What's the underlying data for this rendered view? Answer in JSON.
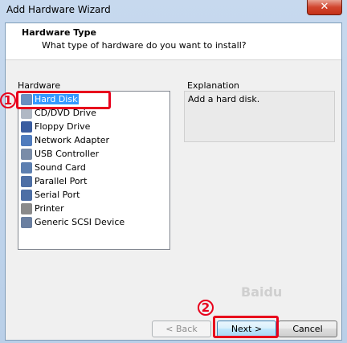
{
  "window": {
    "title": "Add Hardware Wizard",
    "close_glyph": "✕"
  },
  "header": {
    "title": "Hardware Type",
    "subtitle": "What type of hardware do you want to install?"
  },
  "hardware": {
    "label": "Hardware",
    "items": [
      {
        "label": "Hard Disk",
        "icon": "hard-disk-icon",
        "color": "#6a8fc0",
        "selected": true
      },
      {
        "label": "CD/DVD Drive",
        "icon": "cd-dvd-icon",
        "color": "#b0b8c4"
      },
      {
        "label": "Floppy Drive",
        "icon": "floppy-icon",
        "color": "#3b5da0"
      },
      {
        "label": "Network Adapter",
        "icon": "network-icon",
        "color": "#4f7bbd"
      },
      {
        "label": "USB Controller",
        "icon": "usb-icon",
        "color": "#7a8ca8"
      },
      {
        "label": "Sound Card",
        "icon": "sound-icon",
        "color": "#5d7fb0"
      },
      {
        "label": "Parallel Port",
        "icon": "parallel-port-icon",
        "color": "#4e6fa5"
      },
      {
        "label": "Serial Port",
        "icon": "serial-port-icon",
        "color": "#4e6fa5"
      },
      {
        "label": "Printer",
        "icon": "printer-icon",
        "color": "#8a8a8a"
      },
      {
        "label": "Generic SCSI Device",
        "icon": "scsi-icon",
        "color": "#6a7fa0"
      }
    ]
  },
  "explanation": {
    "label": "Explanation",
    "text": "Add a hard disk."
  },
  "buttons": {
    "back": "< Back",
    "next": "Next >",
    "cancel": "Cancel"
  },
  "annotations": {
    "marker1": "1",
    "marker2": "2"
  },
  "watermark": "Baidu"
}
